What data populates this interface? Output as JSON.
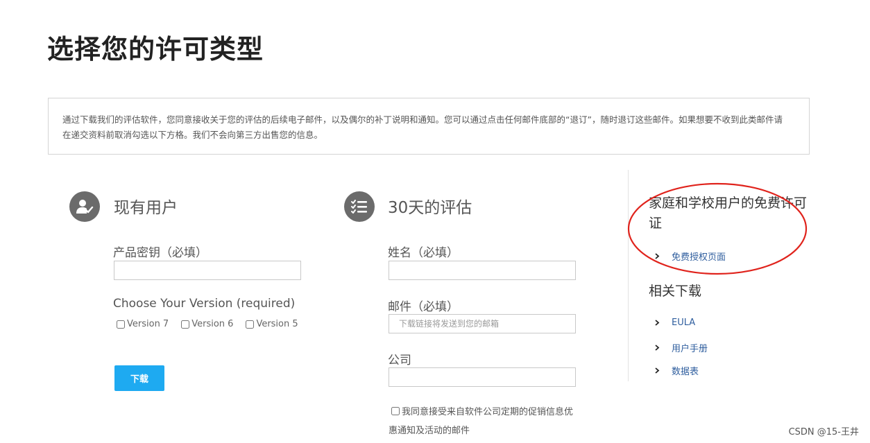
{
  "page": {
    "title": "选择您的许可类型",
    "notice": "通过下载我们的评估软件，您同意接收关于您的评估的后续电子邮件，以及偶尔的补丁说明和通知。您可以通过点击任何邮件底部的“退订”，随时退订这些邮件。如果想要不收到此类邮件请在递交资料前取消勾选以下方格。我们不会向第三方出售您的信息。"
  },
  "existing_user": {
    "icon": "user-check-icon",
    "heading": "现有用户",
    "product_key_label": "产品密钥（必填）",
    "product_key_value": "",
    "version_label": "Choose Your Version (required)",
    "versions": [
      "Version 7",
      "Version 6",
      "Version 5"
    ],
    "download_label": "下载"
  },
  "trial": {
    "icon": "checklist-icon",
    "heading": "30天的评估",
    "name_label": "姓名（必填）",
    "name_value": "",
    "email_label": "邮件（必填）",
    "email_placeholder": "下载链接将发送到您的邮箱",
    "company_label": "公司",
    "company_value": "",
    "consent_label": "我同意接受来自软件公司定期的促销信息优惠通知及活动的邮件"
  },
  "sidebar": {
    "free_heading": "家庭和学校用户的免费许可证",
    "free_link": "免费授权页面",
    "downloads_heading": "相关下载",
    "downloads": [
      "EULA",
      "用户手册",
      "数据表"
    ],
    "annotation_color": "#e0231c"
  },
  "watermark": "CSDN @15-王井"
}
